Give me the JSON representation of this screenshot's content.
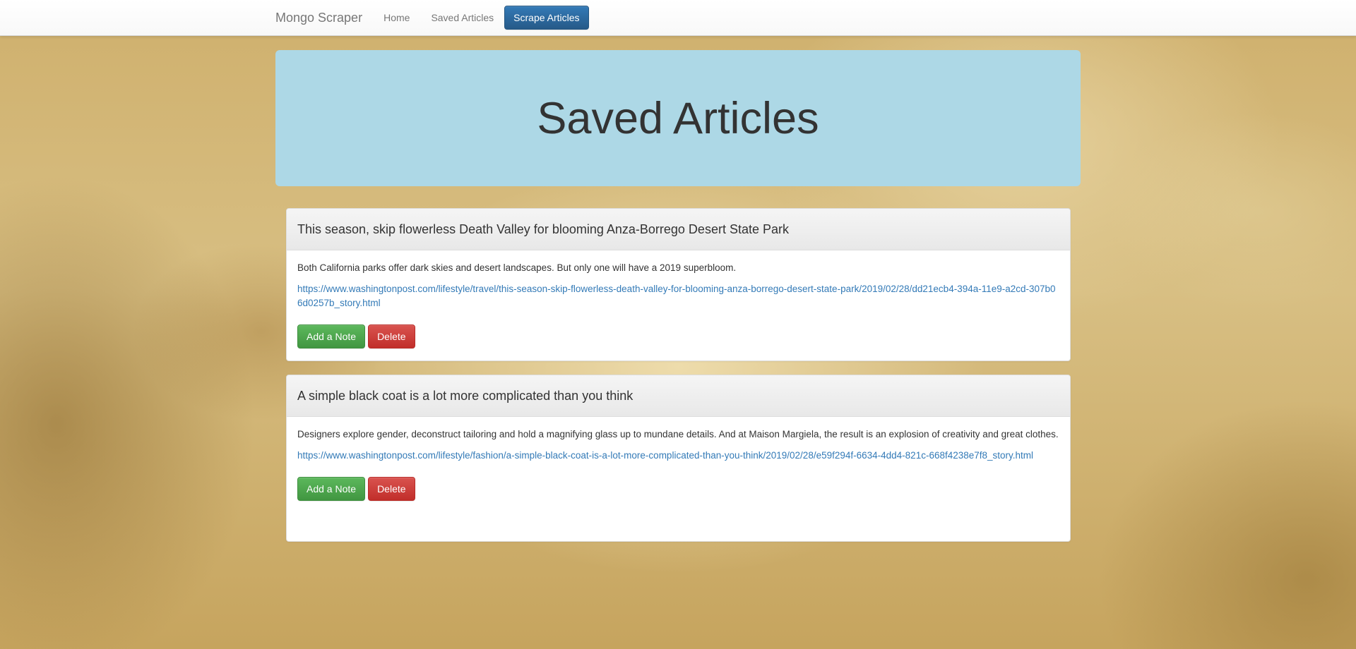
{
  "navbar": {
    "brand": "Mongo Scraper",
    "links": [
      "Home",
      "Saved Articles"
    ],
    "scrape_button": "Scrape Articles"
  },
  "jumbotron": {
    "title": "Saved Articles"
  },
  "articles": [
    {
      "title": "This season, skip flowerless Death Valley for blooming Anza-Borrego Desert State Park",
      "summary": "Both California parks offer dark skies and desert landscapes. But only one will have a 2019 superbloom.",
      "url": "https://www.washingtonpost.com/lifestyle/travel/this-season-skip-flowerless-death-valley-for-blooming-anza-borrego-desert-state-park/2019/02/28/dd21ecb4-394a-11e9-a2cd-307b06d0257b_story.html",
      "add_note_label": "Add a Note",
      "delete_label": "Delete"
    },
    {
      "title": "A simple black coat is a lot more complicated than you think",
      "summary": "Designers explore gender, deconstruct tailoring and hold a magnifying glass up to mundane details. And at Maison Margiela, the result is an explosion of creativity and great clothes.",
      "url": "https://www.washingtonpost.com/lifestyle/fashion/a-simple-black-coat-is-a-lot-more-complicated-than-you-think/2019/02/28/e59f294f-6634-4dd4-821c-668f4238e7f8_story.html",
      "add_note_label": "Add a Note",
      "delete_label": "Delete"
    }
  ],
  "colors": {
    "jumbotron_bg": "#add8e6",
    "primary": "#337ab7",
    "success": "#5cb85c",
    "danger": "#d9534f",
    "link": "#337ab7"
  }
}
